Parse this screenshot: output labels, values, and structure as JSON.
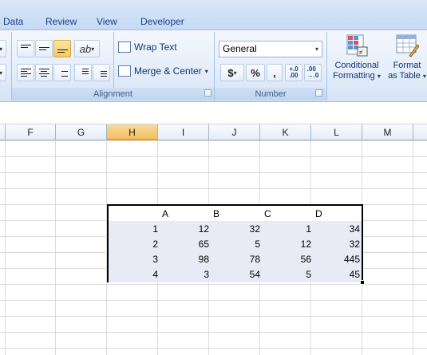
{
  "ribbon": {
    "tabs": [
      "Data",
      "Review",
      "View",
      "Developer"
    ],
    "alignment": {
      "wrap_text": "Wrap Text",
      "merge_center": "Merge & Center",
      "group_label": "Alignment"
    },
    "number": {
      "format_value": "General",
      "currency_symbol": "$",
      "percent_symbol": "%",
      "comma_symbol": ",",
      "increase_decimal": "+.0\n.00",
      "decrease_decimal": ".00\n→.0",
      "group_label": "Number"
    },
    "styles": {
      "conditional_formatting_line1": "Conditional",
      "conditional_formatting_line2": "Formatting",
      "format_as_table_line1": "Format",
      "format_as_table_line2": "as Table"
    }
  },
  "columns": [
    "F",
    "G",
    "H",
    "I",
    "J",
    "K",
    "L",
    "M"
  ],
  "selected_column": "H",
  "table": {
    "headers": [
      "",
      "A",
      "B",
      "C",
      "D"
    ],
    "rows": [
      [
        "1",
        "12",
        "32",
        "1",
        "34"
      ],
      [
        "2",
        "65",
        "5",
        "12",
        "32"
      ],
      [
        "3",
        "98",
        "78",
        "56",
        "445"
      ],
      [
        "4",
        "3",
        "54",
        "5",
        "45"
      ]
    ]
  },
  "colors": {
    "accent": "#15428b",
    "selected_column": "#f1c15f",
    "table_fill": "#e8ebf5"
  }
}
